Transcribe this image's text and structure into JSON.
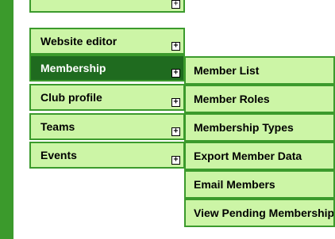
{
  "menu": {
    "items": [
      {
        "label": "Website editor",
        "expand_icon": "+"
      },
      {
        "label": "Membership",
        "expand_icon": "+"
      },
      {
        "label": "Club profile",
        "expand_icon": "+"
      },
      {
        "label": "Teams",
        "expand_icon": "+"
      },
      {
        "label": "Events",
        "expand_icon": "+"
      }
    ]
  },
  "submenu": {
    "items": [
      {
        "label": "Member List"
      },
      {
        "label": "Member Roles"
      },
      {
        "label": "Membership Types"
      },
      {
        "label": "Export Member Data"
      },
      {
        "label": "Email Members"
      },
      {
        "label": "View Pending Memberships"
      }
    ]
  },
  "colors": {
    "accent_green": "#3b9a2c",
    "item_bg": "#ccf5a6",
    "active_bg": "#1f6b1f"
  }
}
